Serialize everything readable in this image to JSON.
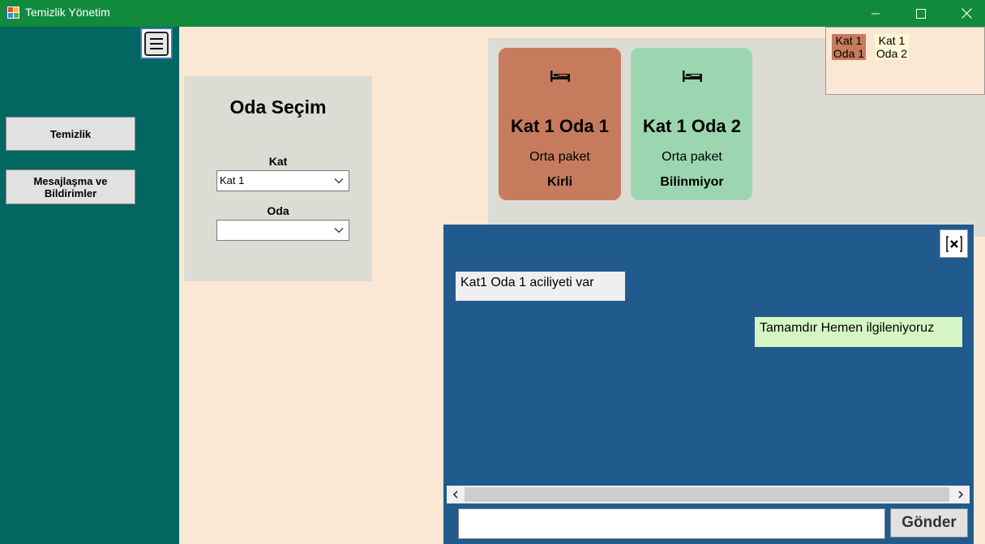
{
  "window": {
    "title": "Temizlik Yönetim",
    "controls": {
      "minimize": "minimize-icon",
      "maximize": "maximize-icon",
      "close": "close-icon"
    }
  },
  "sidebar": {
    "menu_icon": "hamburger-icon",
    "buttons": [
      {
        "label": "Temizlik"
      },
      {
        "label": "Mesajlaşma ve Bildirimler"
      }
    ]
  },
  "room_selector": {
    "title": "Oda Seçim",
    "kat_label": "Kat",
    "kat_value": "Kat 1",
    "oda_label": "Oda",
    "oda_value": ""
  },
  "rooms": [
    {
      "name": "Kat 1 Oda 1",
      "package": "Orta paket",
      "status": "Kirli",
      "color": "#C77B5D",
      "icon": "bed-icon"
    },
    {
      "name": "Kat 1 Oda 2",
      "package": "Orta paket",
      "status": "Bilinmiyor",
      "color": "#9BD6B0",
      "icon": "bed-icon"
    }
  ],
  "mini_rooms": [
    {
      "line1": "Kat 1",
      "line2": "Oda 1",
      "color": "#C77B5D"
    },
    {
      "line1": "Kat 1",
      "line2": "Oda 2",
      "color": "#FFF6D6"
    }
  ],
  "chat": {
    "close_icon": "close-box-icon",
    "messages": [
      {
        "text": "Kat1 Oda 1 aciliyeti var",
        "side": "left",
        "color": "#EFEFEF"
      },
      {
        "text": "Tamamdır Hemen ilgileniyoruz",
        "side": "right",
        "color": "#D6F5C5"
      }
    ],
    "input_value": "",
    "send_label": "Gönder"
  },
  "colors": {
    "titlebar": "#128A3C",
    "sidebar": "#026661",
    "background": "#FBE8D4",
    "panel": "#DCDCD4",
    "chat": "#215B8E"
  }
}
